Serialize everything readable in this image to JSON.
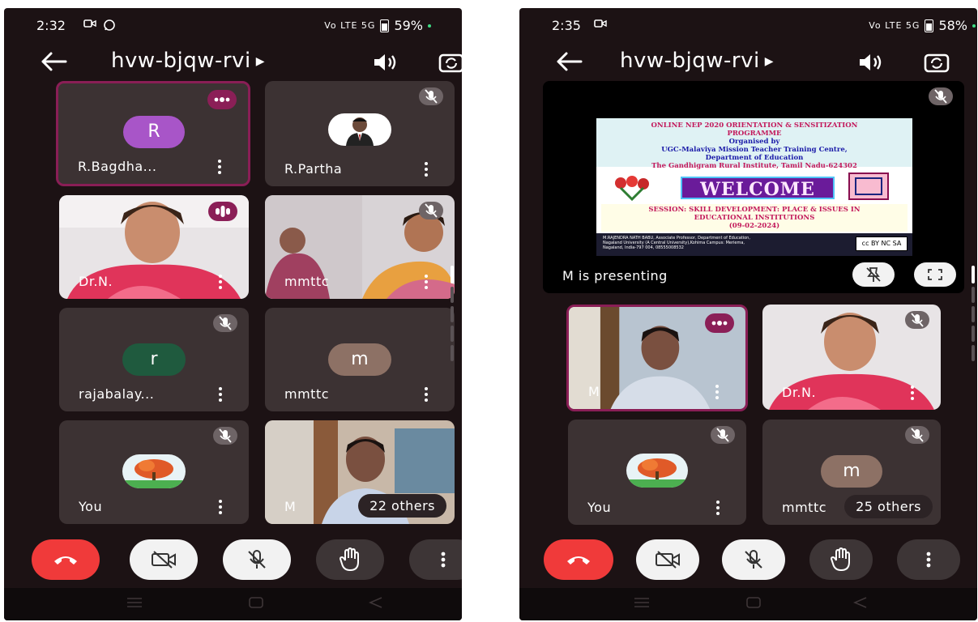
{
  "colors": {
    "end_call": "#f03a3a",
    "speaking_badge": "#8b1f57",
    "tile_bg": "#3c3233",
    "app_bg": "#1c1214"
  },
  "left": {
    "status": {
      "time": "2:32",
      "battery": "59%",
      "network": "Vo LTE 5G"
    },
    "meeting_code": "hvw-bjqw-rvi",
    "tiles": [
      {
        "name": "R.Bagdha...",
        "avatar_letter": "R",
        "avatar_color": "#a855c8",
        "state": "speaking"
      },
      {
        "name": "R.Partha",
        "state": "muted",
        "avatar": "portrait-photo"
      },
      {
        "name": "Dr.N.",
        "state": "speaking",
        "avatar": "video"
      },
      {
        "name": "mmttc",
        "state": "muted",
        "avatar": "video"
      },
      {
        "name": "rajabalay...",
        "avatar_letter": "r",
        "avatar_color": "#1f5a3e",
        "state": "muted"
      },
      {
        "name": "mmttc",
        "avatar_letter": "m",
        "avatar_color": "#8d7165",
        "state": "none"
      },
      {
        "name": "You",
        "state": "muted",
        "avatar": "tree-logo"
      },
      {
        "name": "M",
        "state": "none",
        "avatar": "video",
        "others": "22 others"
      }
    ]
  },
  "right": {
    "status": {
      "time": "2:35",
      "battery": "58%",
      "network": "Vo LTE 5G"
    },
    "meeting_code": "hvw-bjqw-rvi",
    "presentation": {
      "label": "M is presenting",
      "slide": {
        "line1": "ONLINE NEP 2020 ORIENTATION & SENSITIZATION",
        "line2": "PROGRAMME",
        "line3": "Organised by",
        "line4": "UGC-Malaviya Mission Teacher Training Centre,",
        "line5": "Department of Education",
        "line6": "The Gandhigram Rural Institute, Tamil Nadu-624302",
        "welcome": "WELCOME",
        "session1": "SESSION: SKILL DEVELOPMENT: PLACE & ISSUES IN",
        "session2": "EDUCATIONAL INSTITUTIONS",
        "session3": "(09-02-2024)",
        "foot1": "M.RAJENDRA NATH BABU, Associate Professor, Department of Education,",
        "foot2": "Nagaland University (A Central University),Kohima Campus: Meriema,",
        "foot3": "Nagaland, India-797 004, 08555008532",
        "cc": "cc BY NC SA"
      }
    },
    "tiles": [
      {
        "name": "M",
        "state": "speaking",
        "avatar": "video"
      },
      {
        "name": "Dr.N.",
        "state": "muted",
        "avatar": "video"
      },
      {
        "name": "You",
        "state": "muted",
        "avatar": "tree-logo"
      },
      {
        "name": "mmttc",
        "avatar_letter": "m",
        "avatar_color": "#8d7165",
        "state": "muted",
        "others": "25 others"
      }
    ]
  }
}
